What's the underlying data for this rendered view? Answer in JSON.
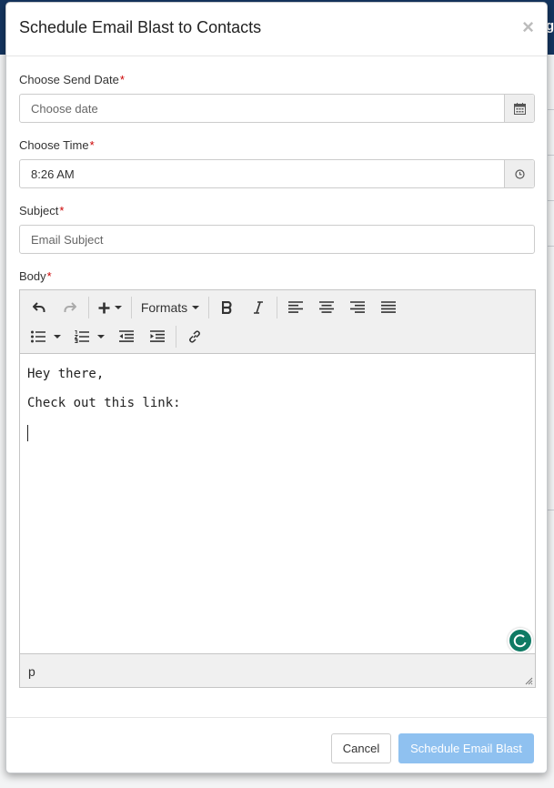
{
  "background": {
    "edge_text": "g"
  },
  "modal": {
    "title": "Schedule Email Blast to Contacts",
    "close_glyph": "×"
  },
  "form": {
    "send_date": {
      "label": "Choose Send Date",
      "required_mark": "*",
      "placeholder": "Choose date",
      "value": "",
      "icon": "calendar-icon"
    },
    "time": {
      "label": "Choose Time",
      "required_mark": "*",
      "value": "8:26 AM",
      "icon": "clock-icon"
    },
    "subject": {
      "label": "Subject",
      "required_mark": "*",
      "placeholder": "Email Subject",
      "value": ""
    },
    "body": {
      "label": "Body",
      "required_mark": "*"
    }
  },
  "editor": {
    "toolbar_row1": [
      "undo-icon",
      "redo-icon",
      "insert-icon",
      "formats-dropdown",
      "bold-icon",
      "italic-icon",
      "align-left-icon",
      "align-center-icon",
      "align-right-icon",
      "align-justify-icon"
    ],
    "toolbar_row2": [
      "bullet-list-icon",
      "numbered-list-icon",
      "outdent-icon",
      "indent-icon",
      "link-icon"
    ],
    "formats_label": "Formats",
    "content_lines": [
      "Hey there,",
      "Check out this link:",
      ""
    ],
    "status_path": "p"
  },
  "footer": {
    "cancel_label": "Cancel",
    "submit_label": "Schedule Email Blast"
  },
  "colors": {
    "accent_disabled": "#8fc1f0",
    "required": "#cc0000",
    "grammarly": "#0f7a64"
  }
}
